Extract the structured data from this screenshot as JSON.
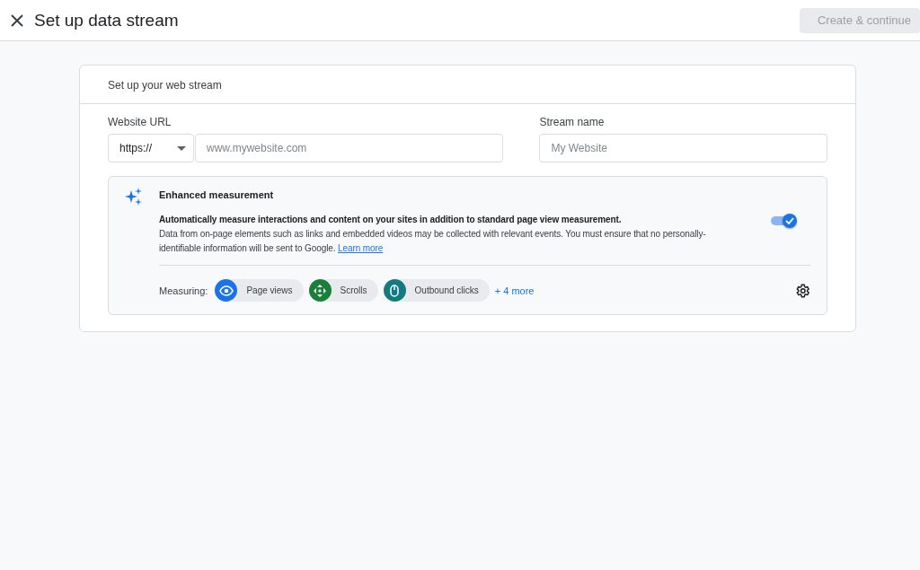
{
  "header": {
    "title": "Set up data stream",
    "primary_button": {
      "label": "Create & continue",
      "disabled": true
    }
  },
  "card": {
    "title": "Set up your web stream",
    "website_url": {
      "label": "Website URL",
      "protocol": "https://",
      "placeholder": "www.mywebsite.com"
    },
    "stream_name": {
      "label": "Stream name",
      "placeholder": "My Website"
    },
    "enhanced_measurement": {
      "title": "Enhanced measurement",
      "on": true,
      "summary": "Automatically measure interactions and content on your sites in addition to standard page view measurement.",
      "details": "Data from on-page elements such as links and embedded videos may be collected with relevant events. You must ensure that no personally-identifiable information will be sent to Google.",
      "link": "Learn more",
      "measuring_label": "Measuring:",
      "events": [
        {
          "label": "Page views",
          "kind": "eye",
          "color": "#1a73e8"
        },
        {
          "label": "Scrolls",
          "kind": "crosshair",
          "color": "#188038"
        },
        {
          "label": "Outbound clicks",
          "kind": "mouse",
          "color": "#137b7f"
        }
      ],
      "more": "+ 4 more"
    }
  }
}
